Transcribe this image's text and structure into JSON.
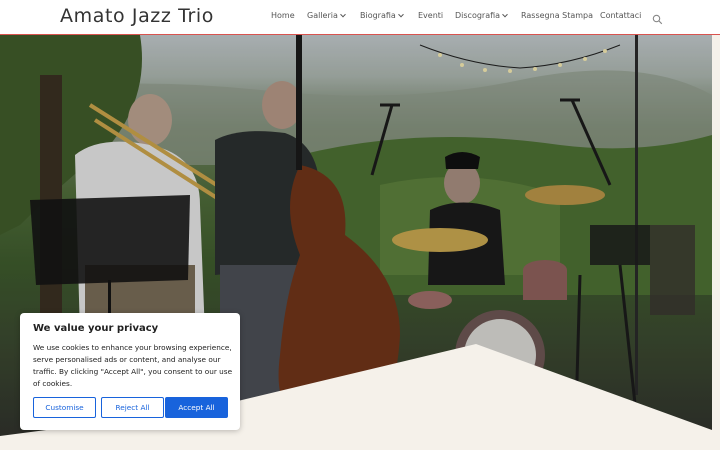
{
  "site": {
    "title": "Amato Jazz Trio"
  },
  "nav": {
    "items": [
      {
        "label": "Home",
        "has_submenu": false
      },
      {
        "label": "Galleria",
        "has_submenu": true
      },
      {
        "label": "Biografia",
        "has_submenu": true
      },
      {
        "label": "Eventi",
        "has_submenu": false
      },
      {
        "label": "Discografia",
        "has_submenu": true
      },
      {
        "label": "Rassegna Stampa",
        "has_submenu": false
      },
      {
        "label": "Contattaci",
        "has_submenu": false
      }
    ],
    "search_icon": "search-icon"
  },
  "hero": {
    "image": "jazz-trio-performing-outdoors-photo"
  },
  "cookie": {
    "title": "We value your privacy",
    "text": "We use cookies to enhance your browsing experience, serve personalised ads or content, and analyse our traffic. By clicking \"Accept All\", you consent to our use of cookies.",
    "customise_label": "Customise",
    "reject_label": "Reject All",
    "accept_label": "Accept All"
  },
  "colors": {
    "accent_line": "#d9534f",
    "cookie_button": "#1863dc",
    "bottom_shape": "#f5f1ea"
  }
}
